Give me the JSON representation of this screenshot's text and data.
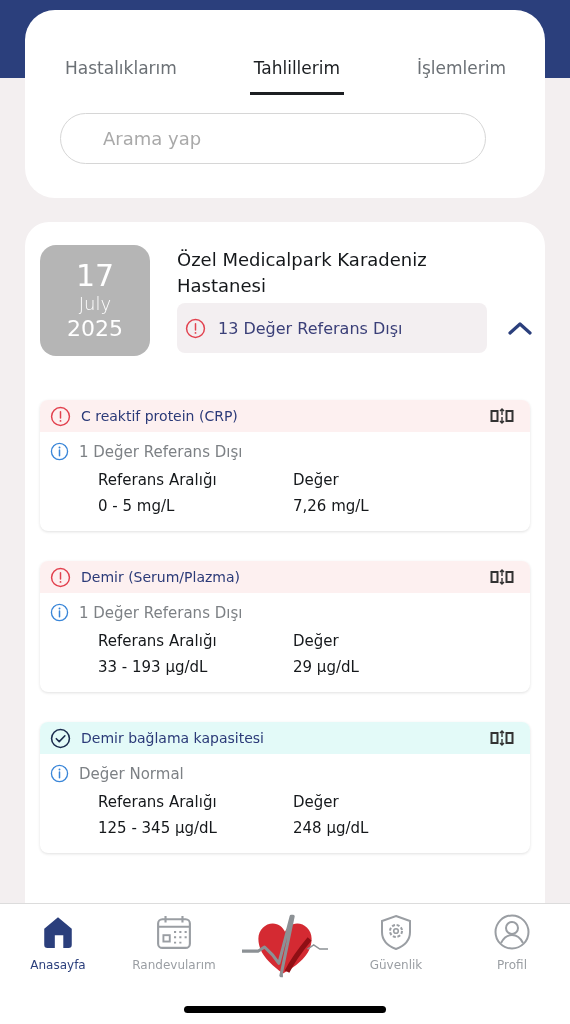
{
  "tabs": [
    {
      "label": "Hastalıklarım",
      "selected": false
    },
    {
      "label": "Tahlillerim",
      "selected": true
    },
    {
      "label": "İşlemlerim",
      "selected": false
    }
  ],
  "search": {
    "placeholder": "Arama yap"
  },
  "record": {
    "day": "17",
    "month": "July",
    "year": "2025",
    "hospital": "Özel Medicalpark Karadeniz Hastanesi",
    "alert": "13 Değer Referans Dışı",
    "expanded": true
  },
  "results": [
    {
      "name": "C reaktif protein (CRP)",
      "kind": "abnormal",
      "note": "1 Değer Referans Dışı",
      "range_label": "Referans Aralığı",
      "range": "0 - 5 mg/L",
      "value_label": "Değer",
      "value": "7,26 mg/L"
    },
    {
      "name": "Demir (Serum/Plazma)",
      "kind": "abnormal",
      "note": "1 Değer Referans Dışı",
      "range_label": "Referans Aralığı",
      "range": "33 - 193 µg/dL",
      "value_label": "Değer",
      "value": "29 µg/dL"
    },
    {
      "name": "Demir bağlama kapasitesi",
      "kind": "normal",
      "note": "Değer Normal",
      "range_label": "Referans Aralığı",
      "range": "125 - 345 µg/dL",
      "value_label": "Değer",
      "value": "248 µg/dL"
    }
  ],
  "nav": [
    {
      "label": "Anasayfa",
      "kind": "home",
      "selected": true
    },
    {
      "label": "Randevularım",
      "kind": "calendar",
      "selected": false
    },
    {
      "kind": "logo",
      "selected": false
    },
    {
      "label": "Güvenlik",
      "kind": "shield",
      "selected": false
    },
    {
      "label": "Profil",
      "kind": "profile",
      "selected": false
    }
  ]
}
